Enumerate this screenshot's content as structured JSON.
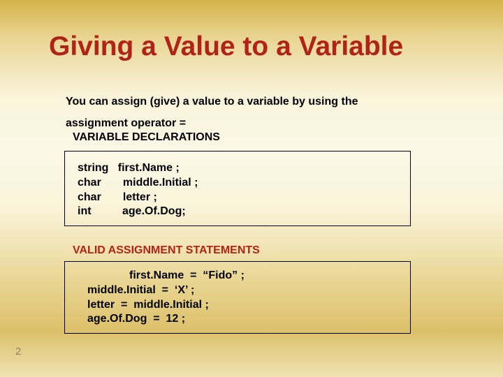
{
  "title": "Giving a Value to a Variable",
  "intro_line1": "You can assign (give) a value to a variable by using the",
  "intro_line2": "assignment operator =",
  "section_decl": "VARIABLE DECLARATIONS",
  "decl": {
    "l1": "string   first.Name ;",
    "l2": "char       middle.Initial ;",
    "l3": "char       letter ;",
    "l4": "int          age.Of.Dog;"
  },
  "section_assign": "VALID ASSIGNMENT STATEMENTS",
  "assign": {
    "l1": "first.Name  =  “Fido” ;",
    "l2": "middle.Initial  =  ‘X’ ;",
    "l3": "letter  =  middle.Initial ;",
    "l4": "age.Of.Dog  =  12 ;"
  },
  "page_number": "2"
}
